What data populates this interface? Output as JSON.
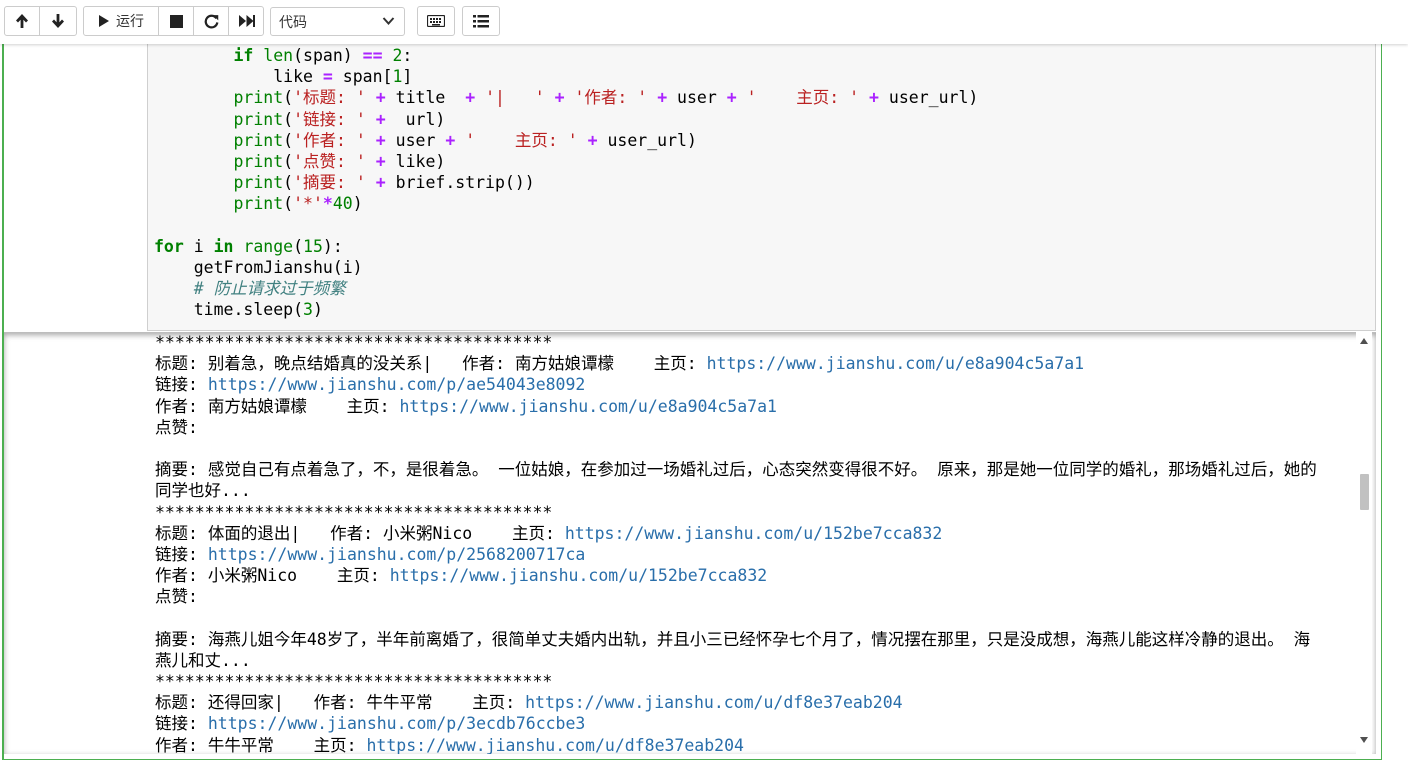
{
  "toolbar": {
    "run_label": "运行",
    "cell_type": "代码",
    "icons": [
      "arrow-up-icon",
      "arrow-down-icon",
      "play-icon",
      "stop-icon",
      "restart-icon",
      "fast-forward-icon",
      "chevron-down-icon",
      "keyboard-icon",
      "list-icon"
    ]
  },
  "code": {
    "lines": [
      "        if len(span) == 2:",
      "            like = span[1]",
      "        print('标题: ' + title  + '|   ' + '作者: ' + user + '    主页: ' + user_url)",
      "        print('链接: ' +  url)",
      "        print('作者: ' + user + '    主页: ' + user_url)",
      "        print('点赞: ' + like)",
      "        print('摘要: ' + brief.strip())",
      "        print('*'*40)",
      "",
      "for i in range(15):",
      "    getFromJianshu(i)",
      "    # 防止请求过于频繁",
      "    time.sleep(3)"
    ]
  },
  "output": {
    "separator": "****************************************",
    "entries": [
      {
        "title_prefix": "标题: 别着急，晚点结婚真的没关系|   作者: 南方姑娘谭檬    主页: ",
        "user_url": "https://www.jianshu.com/u/e8a904c5a7a1",
        "link_prefix": "链接: ",
        "url": "https://www.jianshu.com/p/ae54043e8092",
        "author_prefix": "作者: 南方姑娘谭檬    主页: ",
        "likes": "点赞: ",
        "brief": "摘要: 感觉自己有点着急了，不，是很着急。 一位姑娘，在参加过一场婚礼过后，心态突然变得很不好。 原来，那是她一位同学的婚礼，那场婚礼过后，她的同学也好..."
      },
      {
        "title_prefix": "标题: 体面的退出|   作者: 小米粥Nico    主页: ",
        "user_url": "https://www.jianshu.com/u/152be7cca832",
        "link_prefix": "链接: ",
        "url": "https://www.jianshu.com/p/2568200717ca",
        "author_prefix": "作者: 小米粥Nico    主页: ",
        "likes": "点赞: ",
        "brief": "摘要: 海燕儿姐今年48岁了，半年前离婚了，很简单丈夫婚内出轨，并且小三已经怀孕七个月了，情况摆在那里，只是没成想，海燕儿能这样冷静的退出。 海燕儿和丈..."
      },
      {
        "title_prefix": "标题: 还得回家|   作者: 牛牛平常    主页: ",
        "user_url": "https://www.jianshu.com/u/df8e37eab204",
        "link_prefix": "链接: ",
        "url": "https://www.jianshu.com/p/3ecdb76ccbe3",
        "author_prefix": "作者: 牛牛平常    主页: ",
        "likes": "",
        "brief": ""
      }
    ]
  }
}
